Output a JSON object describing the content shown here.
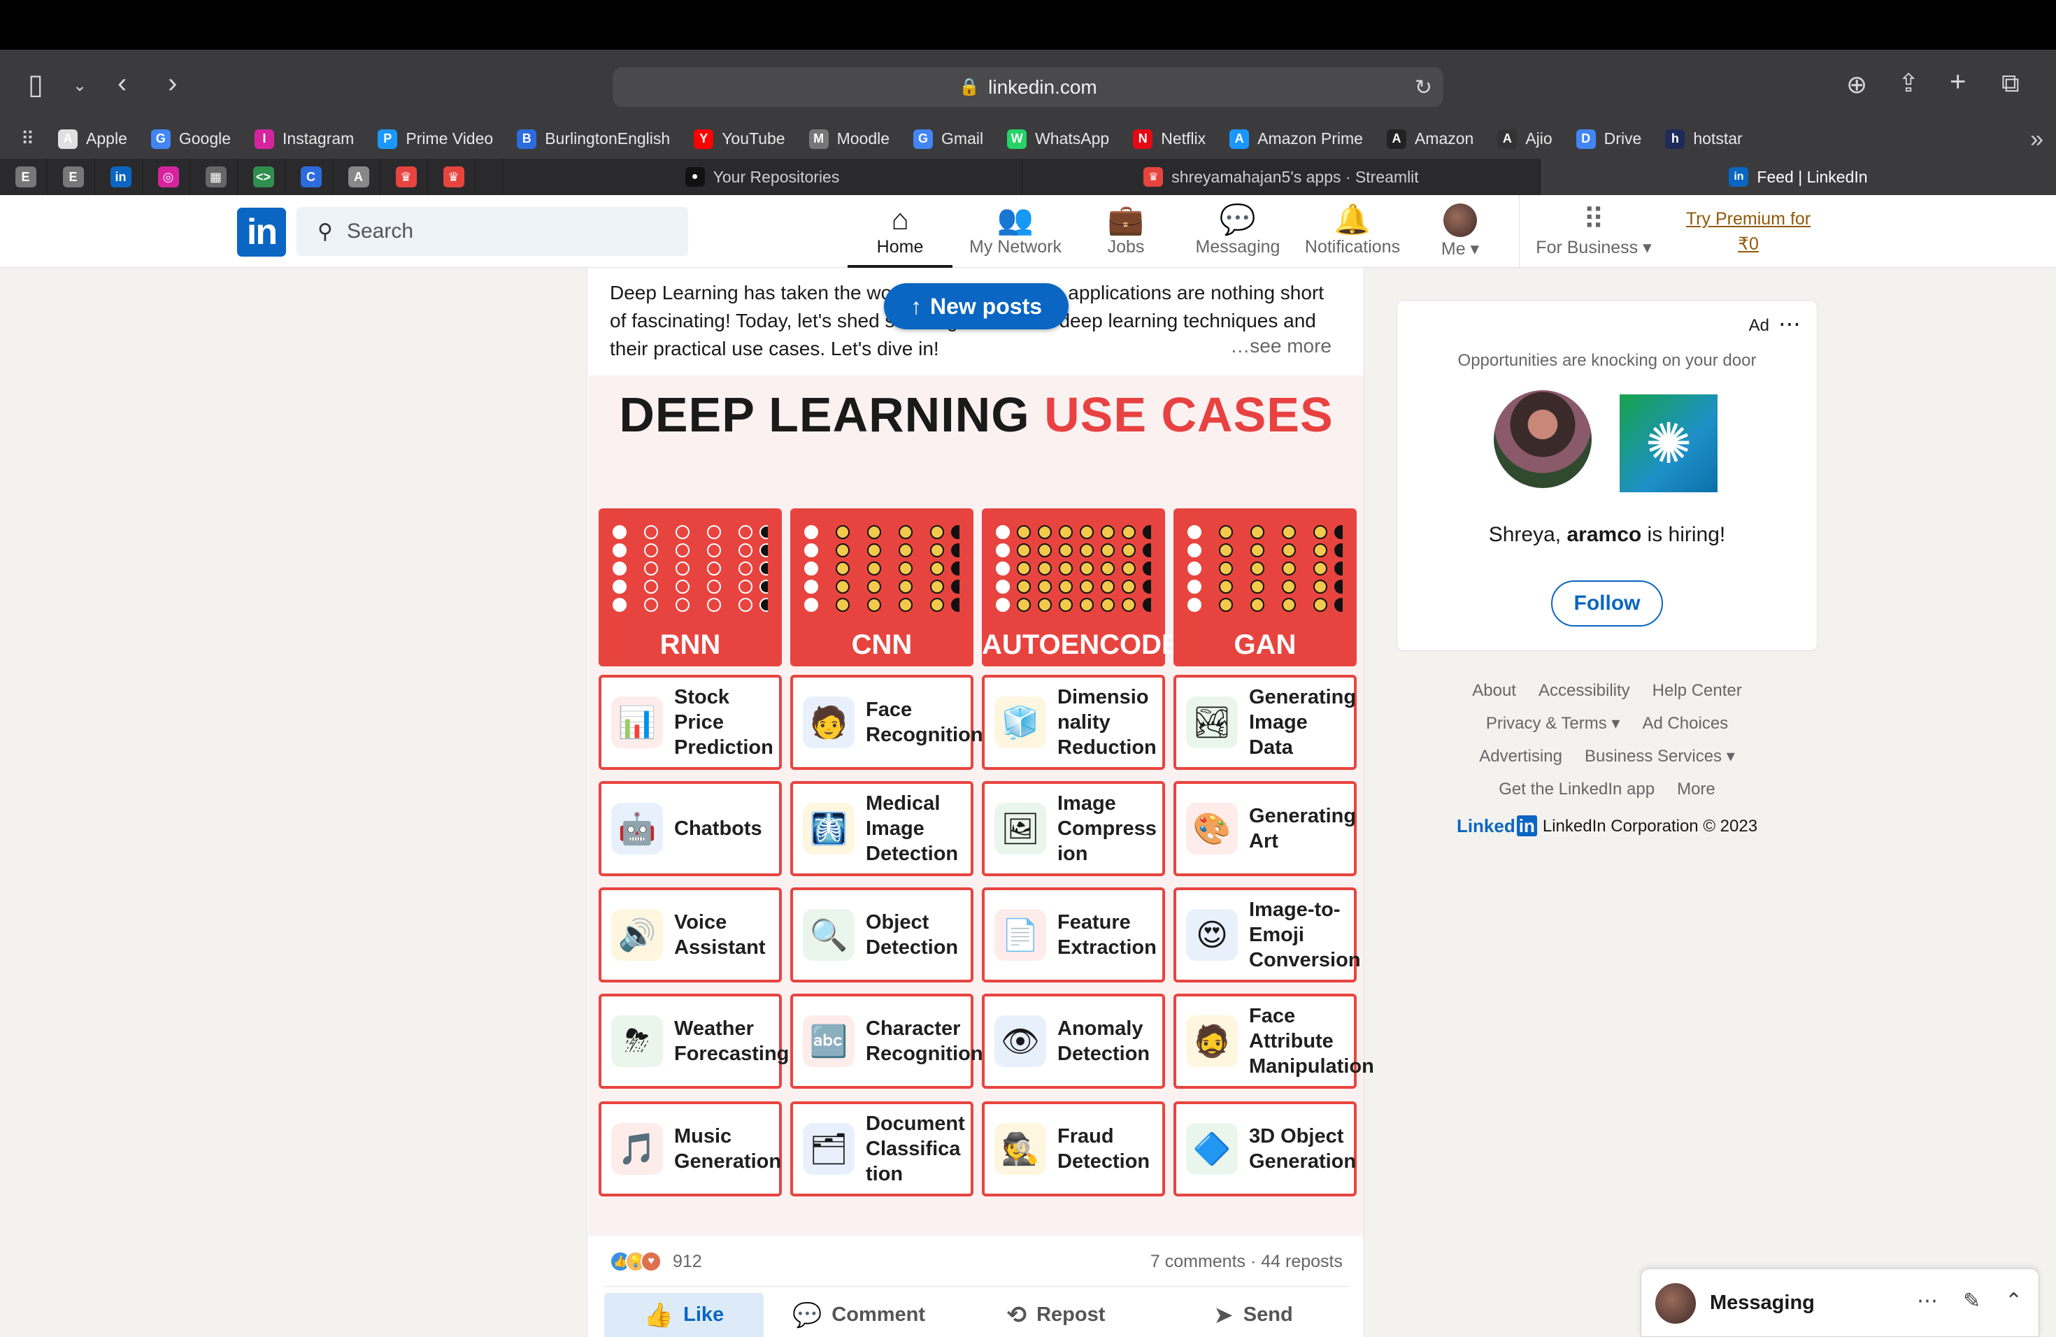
{
  "browser": {
    "url": "linkedin.com",
    "bookmarks": [
      {
        "label": "Apple",
        "icon": "apple-icon",
        "color": "#e0e0e0"
      },
      {
        "label": "Google",
        "icon": "google-icon",
        "color": "#4285f4"
      },
      {
        "label": "Instagram",
        "icon": "instagram-icon",
        "color": "#d6249f"
      },
      {
        "label": "Prime Video",
        "icon": "prime-video-icon",
        "color": "#1a98ff"
      },
      {
        "label": "BurlingtonEnglish",
        "icon": "burlington-icon",
        "color": "#2d6cdf"
      },
      {
        "label": "YouTube",
        "icon": "youtube-icon",
        "color": "#ff0000"
      },
      {
        "label": "Moodle",
        "icon": "moodle-icon",
        "color": "#777777"
      },
      {
        "label": "Gmail",
        "icon": "google-icon",
        "color": "#4285f4"
      },
      {
        "label": "WhatsApp",
        "icon": "whatsapp-icon",
        "color": "#25d366"
      },
      {
        "label": "Netflix",
        "icon": "netflix-icon",
        "color": "#e50914"
      },
      {
        "label": "Amazon Prime",
        "icon": "prime-video-icon",
        "color": "#1a98ff"
      },
      {
        "label": "Amazon",
        "icon": "amazon-icon",
        "color": "#222222"
      },
      {
        "label": "Ajio",
        "icon": "ajio-icon",
        "color": "#333333"
      },
      {
        "label": "Drive",
        "icon": "google-icon",
        "color": "#4285f4"
      },
      {
        "label": "hotstar",
        "icon": "hotstar-icon",
        "color": "#1f2a5a"
      }
    ],
    "pinned_tabs": [
      {
        "glyph": "E",
        "color": "#777777",
        "name": "pinned-tab-e1"
      },
      {
        "glyph": "E",
        "color": "#777777",
        "name": "pinned-tab-e2"
      },
      {
        "glyph": "in",
        "color": "#0a66c2",
        "name": "pinned-tab-linkedin"
      },
      {
        "glyph": "◎",
        "color": "#d6249f",
        "name": "pinned-tab-instagram"
      },
      {
        "glyph": "▦",
        "color": "#666666",
        "name": "pinned-tab-cisco"
      },
      {
        "glyph": "<>",
        "color": "#2f8f4f",
        "name": "pinned-tab-code"
      },
      {
        "glyph": "C",
        "color": "#2d6cdf",
        "name": "pinned-tab-c"
      },
      {
        "glyph": "A",
        "color": "#888888",
        "name": "pinned-tab-a"
      },
      {
        "glyph": "♛",
        "color": "#e8443f",
        "name": "pinned-tab-streamlit1"
      },
      {
        "glyph": "♛",
        "color": "#e8443f",
        "name": "pinned-tab-streamlit2"
      }
    ],
    "tabs": [
      {
        "title": "Your Repositories",
        "icon": "github-icon",
        "glyph": "●",
        "color": "#111111"
      },
      {
        "title": "shreyamahajan5's apps · Streamlit",
        "icon": "streamlit-icon",
        "glyph": "♛",
        "color": "#e8443f"
      },
      {
        "title": "Feed | LinkedIn",
        "icon": "linkedin-icon",
        "glyph": "in",
        "color": "#0a66c2"
      }
    ]
  },
  "header": {
    "search_placeholder": "Search",
    "nav": [
      {
        "label": "Home",
        "icon": "home-icon",
        "glyph": "⌂",
        "active": true
      },
      {
        "label": "My Network",
        "icon": "network-icon",
        "glyph": "👥"
      },
      {
        "label": "Jobs",
        "icon": "briefcase-icon",
        "glyph": "💼"
      },
      {
        "label": "Messaging",
        "icon": "chat-icon",
        "glyph": "💬"
      },
      {
        "label": "Notifications",
        "icon": "bell-icon",
        "glyph": "🔔"
      },
      {
        "label": "Me ▾",
        "icon": "avatar"
      },
      {
        "label": "For Business ▾",
        "icon": "grid-icon",
        "glyph": "⠿"
      }
    ],
    "premium_line1": "Try Premium for",
    "premium_line2": "₹0"
  },
  "post": {
    "text": "Deep Learning has taken the world by storm, and its applications are nothing short of fascinating! Today, let's shed some light on a few deep learning techniques and their practical use cases. Let's dive in!",
    "see_more": "…see more",
    "new_posts": "New posts",
    "reactions_count": "912",
    "comments_reposts": "7 comments · 44 reposts",
    "actions": {
      "like": "Like",
      "comment": "Comment",
      "repost": "Repost",
      "send": "Send"
    }
  },
  "infographic": {
    "title_part1": "DEEP LEARNING",
    "title_part2": "USE CASES",
    "columns": [
      "RNN",
      "CNN",
      "AUTOENCODER",
      "GAN"
    ],
    "cells": [
      [
        {
          "label": "Stock Price Prediction",
          "icon": "stock-chart-icon",
          "glyph": "📊"
        },
        {
          "label": "Face Recognition",
          "icon": "face-scan-icon",
          "glyph": "🧑"
        },
        {
          "label": "Dimensionality Reduction",
          "icon": "cube-icon",
          "glyph": "🧊"
        },
        {
          "label": "Generating Image Data",
          "icon": "image-icon",
          "glyph": "🏞"
        }
      ],
      [
        {
          "label": "Chatbots",
          "icon": "robot-icon",
          "glyph": "🤖"
        },
        {
          "label": "Medical Image Detection",
          "icon": "medical-scan-icon",
          "glyph": "🩻"
        },
        {
          "label": "Image Compression",
          "icon": "compress-image-icon",
          "glyph": "🖼"
        },
        {
          "label": "Generating Art",
          "icon": "palette-icon",
          "glyph": "🎨"
        }
      ],
      [
        {
          "label": "Voice Assistant",
          "icon": "smart-speaker-icon",
          "glyph": "🔊"
        },
        {
          "label": "Object Detection",
          "icon": "magnifier-icon",
          "glyph": "🔍"
        },
        {
          "label": "Feature Extraction",
          "icon": "document-icon",
          "glyph": "📄"
        },
        {
          "label": "Image-to-Emoji Conversion",
          "icon": "emoji-icon",
          "glyph": "😍"
        }
      ],
      [
        {
          "label": "Weather Forecasting",
          "icon": "storm-cloud-icon",
          "glyph": "⛈"
        },
        {
          "label": "Character Recognition",
          "icon": "abc-blocks-icon",
          "glyph": "🔤"
        },
        {
          "label": "Anomaly Detection",
          "icon": "eye-scan-icon",
          "glyph": "👁"
        },
        {
          "label": "Face Attribute Manipulation",
          "icon": "face-edit-icon",
          "glyph": "🧔"
        }
      ],
      [
        {
          "label": "Music Generation",
          "icon": "music-note-icon",
          "glyph": "🎵"
        },
        {
          "label": "Document Classification",
          "icon": "binders-icon",
          "glyph": "🗂"
        },
        {
          "label": "Fraud Detection",
          "icon": "fraud-search-icon",
          "glyph": "🕵"
        },
        {
          "label": "3D Object Generation",
          "icon": "3d-cube-icon",
          "glyph": "🔷"
        }
      ]
    ],
    "cell_display": [
      [
        [
          "Stock",
          "Price",
          "Prediction"
        ],
        [
          "Face",
          "Recognition"
        ],
        [
          "Dimensio",
          "nality",
          "Reduction"
        ],
        [
          "Generating",
          "Image",
          "Data"
        ]
      ],
      [
        [
          "Chatbots"
        ],
        [
          "Medical",
          "Image",
          "Detection"
        ],
        [
          "Image",
          "Compress",
          "ion"
        ],
        [
          "Generating",
          "Art"
        ]
      ],
      [
        [
          "Voice",
          "Assistant"
        ],
        [
          "Object",
          "Detection"
        ],
        [
          "Feature",
          "Extraction"
        ],
        [
          "Image-to-",
          "Emoji",
          "Conversion"
        ]
      ],
      [
        [
          "Weather",
          "Forecasting"
        ],
        [
          "Character",
          "Recognition"
        ],
        [
          "Anomaly",
          "Detection"
        ],
        [
          "Face",
          "Attribute",
          "Manipulation"
        ]
      ],
      [
        [
          "Music",
          "Generation"
        ],
        [
          "Document",
          "Classifica",
          "tion"
        ],
        [
          "Fraud",
          "Detection"
        ],
        [
          "3D Object",
          "Generation"
        ]
      ]
    ]
  },
  "ad": {
    "label": "Ad",
    "subtitle": "Opportunities are knocking on your door",
    "hiring_prefix": "Shreya, ",
    "company": "aramco",
    "hiring_suffix": " is hiring!",
    "follow": "Follow"
  },
  "footer": {
    "rows": [
      [
        "About",
        "Accessibility",
        "Help Center"
      ],
      [
        "Privacy & Terms ▾",
        "Ad Choices"
      ],
      [
        "Advertising",
        "Business Services ▾"
      ],
      [
        "Get the LinkedIn app",
        "More"
      ]
    ],
    "brand": "Linked",
    "brand_in": "in",
    "copyright": "LinkedIn Corporation © 2023"
  },
  "messaging": {
    "label": "Messaging"
  }
}
